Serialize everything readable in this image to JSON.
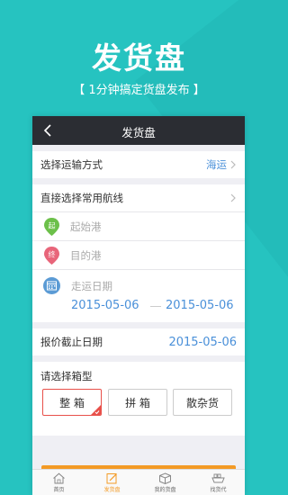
{
  "promo": {
    "title": "发货盘",
    "subtitle": "【 1分钟搞定货盘发布 】"
  },
  "nav": {
    "title": "发货盘",
    "back_icon": "chevron-left-icon"
  },
  "transport": {
    "label": "选择运输方式",
    "value": "海运"
  },
  "route": {
    "label": "直接选择常用航线",
    "origin_icon_text": "起",
    "origin_placeholder": "起始港",
    "dest_icon_text": "终",
    "dest_placeholder": "目的港"
  },
  "shipping_date": {
    "label": "走运日期",
    "start": "2015-05-06",
    "end": "2015-05-06"
  },
  "deadline": {
    "label": "报价截止日期",
    "value": "2015-05-06"
  },
  "box_type": {
    "title": "请选择箱型",
    "options": [
      {
        "label": "整 箱",
        "selected": true
      },
      {
        "label": "拼 箱",
        "selected": false
      },
      {
        "label": "散杂货",
        "selected": false
      }
    ]
  },
  "tabbar": {
    "items": [
      {
        "label": "首页",
        "icon": "home-icon",
        "active": false
      },
      {
        "label": "发货盘",
        "icon": "edit-icon",
        "active": true
      },
      {
        "label": "我的货盘",
        "icon": "box-icon",
        "active": false
      },
      {
        "label": "找货代",
        "icon": "ship-icon",
        "active": false
      }
    ]
  },
  "colors": {
    "background": "#26c3c0",
    "navbar": "#2b2d33",
    "accent_blue": "#4a90d9",
    "selected_red": "#e8504a",
    "accent_orange": "#f39a25",
    "origin_pin": "#6cc04a",
    "dest_pin": "#e8657a",
    "calendar": "#5b9bd5"
  }
}
